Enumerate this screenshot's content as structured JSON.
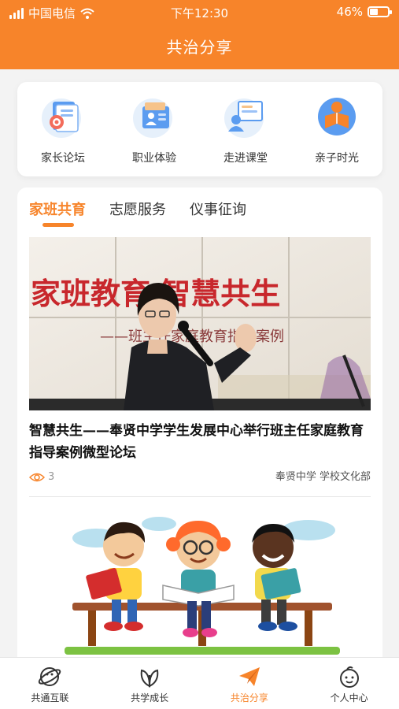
{
  "status_bar": {
    "carrier": "中国电信",
    "time": "下午12:30",
    "battery": "46%",
    "battery_level": 0.46
  },
  "header": {
    "title": "共治分享"
  },
  "quick_menu": [
    {
      "label": "家长论坛",
      "icon": "parent-forum-icon"
    },
    {
      "label": "职业体验",
      "icon": "career-experience-icon"
    },
    {
      "label": "走进课堂",
      "icon": "classroom-icon"
    },
    {
      "label": "亲子时光",
      "icon": "family-time-icon"
    }
  ],
  "tabs": [
    {
      "label": "家班共育",
      "active": true
    },
    {
      "label": "志愿服务",
      "active": false
    },
    {
      "label": "仪事征询",
      "active": false
    }
  ],
  "articles": [
    {
      "title": "智慧共生——奉贤中学学生发展中心举行班主任家庭教育指导案例微型论坛",
      "views": "3",
      "source": "奉贤中学 学校文化部",
      "image_texts": {
        "line1": "家班教育 智慧共生",
        "line2": "——班主任家庭教育指导案例"
      }
    }
  ],
  "tabbar": [
    {
      "label": "共通互联",
      "icon": "planet-icon",
      "active": false
    },
    {
      "label": "共学成长",
      "icon": "leaf-icon",
      "active": false
    },
    {
      "label": "共治分享",
      "icon": "paper-plane-icon",
      "active": true
    },
    {
      "label": "个人中心",
      "icon": "person-face-icon",
      "active": false
    }
  ],
  "colors": {
    "accent": "#f7842a",
    "header_bg": "#f7842a",
    "page_bg": "#f3f3f3"
  }
}
